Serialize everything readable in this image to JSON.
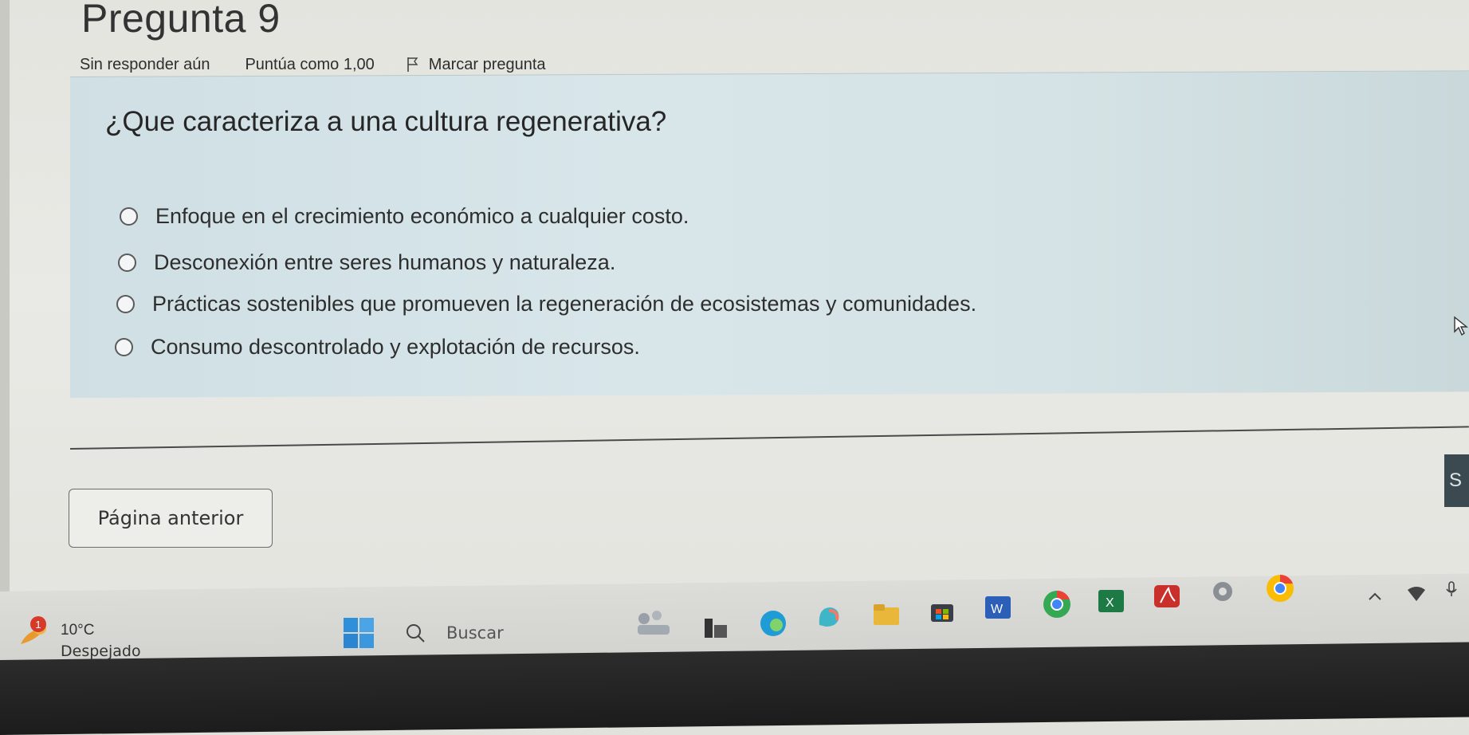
{
  "question": {
    "title": "Pregunta 9",
    "status": "Sin responder aún",
    "score": "Puntúa como 1,00",
    "flag_label": "Marcar pregunta",
    "text": "¿Que caracteriza a una cultura regenerativa?",
    "options": [
      "Enfoque en el crecimiento económico a cualquier costo.",
      "Desconexión entre seres humanos y naturaleza.",
      "Prácticas sostenibles que promueven la regeneración de ecosistemas y comunidades.",
      "Consumo descontrolado y explotación de recursos."
    ]
  },
  "navigation": {
    "prev_label": "Página anterior",
    "next_label_partial": "S"
  },
  "taskbar": {
    "weather_badge": "1",
    "temperature": "10°C",
    "weather_desc": "Despejado",
    "search_placeholder": "Buscar",
    "pinned": [
      "widgets-icon",
      "task-view-icon",
      "edge-icon",
      "copilot-icon",
      "file-explorer-icon",
      "store-icon",
      "word-icon",
      "chrome-icon",
      "excel-icon",
      "acrobat-icon",
      "settings-icon",
      "chrome-profile-icon"
    ],
    "tray": [
      "chevron-up-icon",
      "network-icon",
      "mic-icon"
    ]
  },
  "colors": {
    "question_bg": "#d8e6ea",
    "page_bg": "#e6e6e2",
    "accent_dark": "#3a4a50"
  }
}
